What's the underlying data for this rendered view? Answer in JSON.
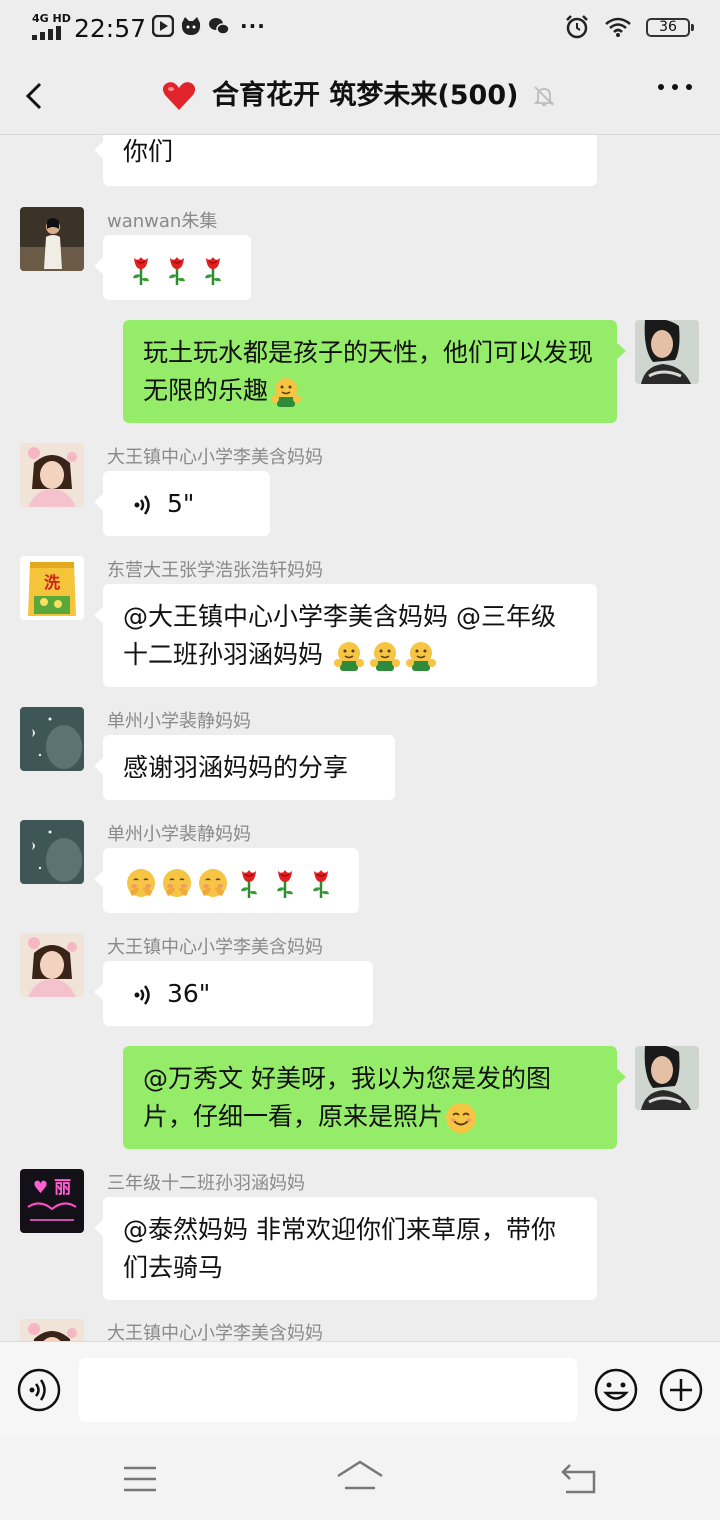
{
  "status_bar": {
    "network": "4G HD",
    "time": "22:57",
    "battery": "36",
    "more": "···"
  },
  "header": {
    "title": "合育花开 筑梦未来(500)",
    "back_icon": "chevron-left-icon",
    "heart_icon": "red-heart-icon",
    "mute_icon": "bell-muted-icon",
    "more_icon": "more-dots-icon"
  },
  "messages": [
    {
      "type": "text",
      "side": "in",
      "text": "你们"
    },
    {
      "type": "text",
      "side": "in",
      "sender": "wanwan朱集",
      "emojis": [
        "rose",
        "rose",
        "rose"
      ]
    },
    {
      "type": "text",
      "side": "out",
      "text": "玩土玩水都是孩子的天性，他们可以发现无限的乐趣",
      "emojis": [
        "hug"
      ]
    },
    {
      "type": "voice",
      "side": "in",
      "sender": "大王镇中心小学李美含妈妈",
      "duration": "5\""
    },
    {
      "type": "text",
      "side": "in",
      "sender": "东营大王张学浩张浩轩妈妈",
      "text": "@大王镇中心小学李美含妈妈 @三年级十二班孙羽涵妈妈 ",
      "emojis": [
        "hug",
        "hug",
        "hug"
      ]
    },
    {
      "type": "text",
      "side": "in",
      "sender": "单州小学裴静妈妈",
      "text": "感谢羽涵妈妈的分享"
    },
    {
      "type": "text",
      "side": "in",
      "sender": "单州小学裴静妈妈",
      "emojis": [
        "shy",
        "shy",
        "shy",
        "rose",
        "rose",
        "rose"
      ]
    },
    {
      "type": "voice",
      "side": "in",
      "sender": "大王镇中心小学李美含妈妈",
      "duration": "36\""
    },
    {
      "type": "text",
      "side": "out",
      "text": "@万秀文  好美呀，我以为您是发的图片，仔细一看，原来是照片",
      "emojis": [
        "smile"
      ]
    },
    {
      "type": "text",
      "side": "in",
      "sender": "三年级十二班孙羽涵妈妈",
      "text": "@泰然妈妈  非常欢迎你们来草原，带你们去骑马"
    },
    {
      "type": "partial",
      "side": "in",
      "sender": "大王镇中心小学李美含妈妈"
    }
  ],
  "avatar_badges": {
    "zhang": "洗",
    "sun": "♥ 丽"
  },
  "input_bar": {
    "value": "",
    "voice_icon": "voice-input-icon",
    "emoji_icon": "emoji-icon",
    "plus_icon": "plus-icon"
  },
  "nav_bar": {
    "icons": [
      "menu-icon",
      "home-icon",
      "back-icon"
    ]
  },
  "colors": {
    "background": "#ededed",
    "incoming_bubble": "#ffffff",
    "outgoing_bubble": "#95ec69",
    "sender_name": "#8a8a8a"
  }
}
